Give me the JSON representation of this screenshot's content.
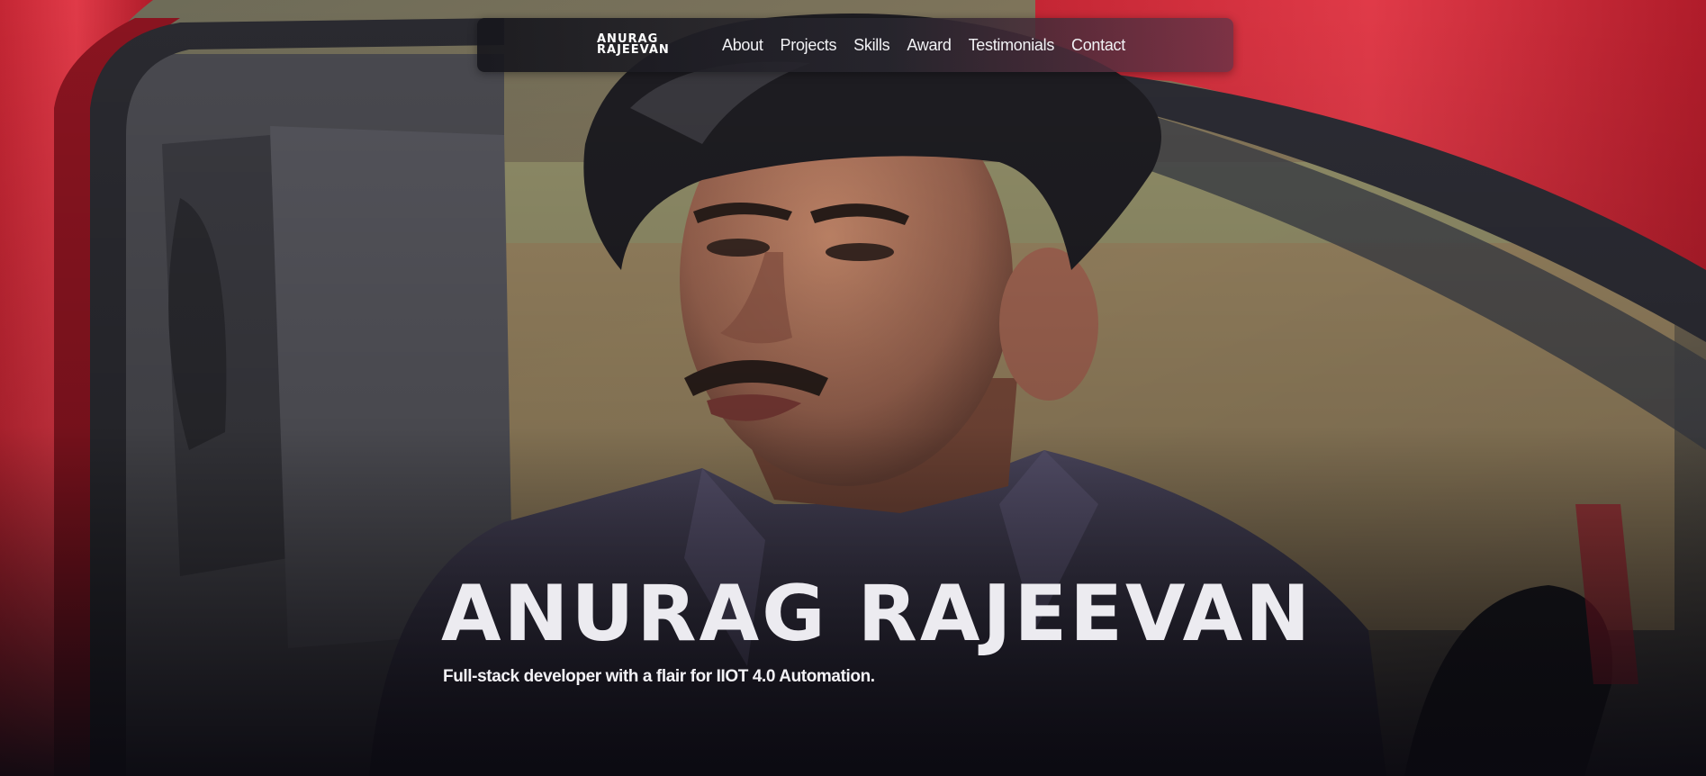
{
  "colors": {
    "car_red": "#d8303c",
    "nav_bg": "#1c1b22",
    "text": "#ecebf0",
    "shirt": "#4a4458",
    "hair": "#1e1d22",
    "skin": "#a9705a"
  },
  "nav": {
    "logo": {
      "line1": "ANURAG",
      "line2": "RAJEEVAN"
    },
    "links": [
      "About",
      "Projects",
      "Skills",
      "Award",
      "Testimonials",
      "Contact"
    ]
  },
  "hero": {
    "photo_description_icon": "portrait-in-red-car",
    "title": "ANURAG RAJEEVAN",
    "subtitle": "Full-stack developer with a flair for IIOT 4.0 Automation."
  }
}
